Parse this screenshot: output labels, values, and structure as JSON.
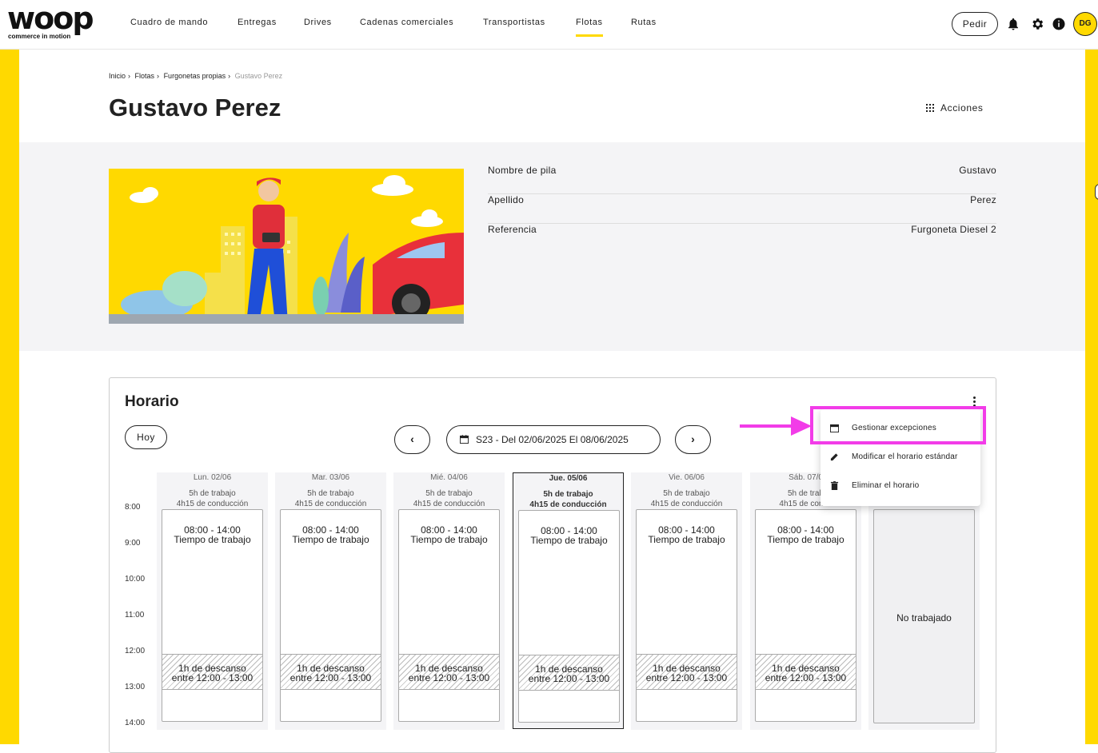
{
  "brand": {
    "logo_text": "woop",
    "tagline": "commerce in motion",
    "accent": "#ffd900"
  },
  "nav": {
    "items": [
      "Cuadro de mando",
      "Entregas",
      "Drives",
      "Cadenas comerciales",
      "Transportistas",
      "Flotas",
      "Rutas"
    ],
    "active": "Flotas",
    "pedir_label": "Pedir",
    "avatar_initials": "DG"
  },
  "breadcrumb": [
    "Inicio",
    "Flotas",
    "Furgonetas propias",
    "Gustavo Perez"
  ],
  "page_title": "Gustavo Perez",
  "acciones_label": "Acciones",
  "info": [
    {
      "key": "Nombre de pila",
      "value": "Gustavo"
    },
    {
      "key": "Apellido",
      "value": "Perez"
    },
    {
      "key": "Referencia",
      "value": "Furgoneta Diesel 2"
    }
  ],
  "schedule": {
    "title": "Horario",
    "today_label": "Hoy",
    "week_label": "S23 - Del 02/06/2025 El 08/06/2025",
    "hours": [
      "8:00",
      "9:00",
      "10:00",
      "11:00",
      "12:00",
      "13:00",
      "14:00"
    ],
    "days": [
      {
        "name": "Lun. 02/06",
        "work": "5h de trabajo",
        "drive": "4h15 de conducción",
        "slot": "08:00 - 14:00",
        "slot_label": "Tiempo de trabajo",
        "break1": "1h de descanso",
        "break2": "entre 12:00 - 13:00"
      },
      {
        "name": "Mar. 03/06",
        "work": "5h de trabajo",
        "drive": "4h15 de conducción",
        "slot": "08:00 - 14:00",
        "slot_label": "Tiempo de trabajo",
        "break1": "1h de descanso",
        "break2": "entre 12:00 - 13:00"
      },
      {
        "name": "Mié. 04/06",
        "work": "5h de trabajo",
        "drive": "4h15 de conducción",
        "slot": "08:00 - 14:00",
        "slot_label": "Tiempo de trabajo",
        "break1": "1h de descanso",
        "break2": "entre 12:00 - 13:00"
      },
      {
        "name": "Jue. 05/06",
        "work": "5h de trabajo",
        "drive": "4h15 de conducción",
        "slot": "08:00 - 14:00",
        "slot_label": "Tiempo de trabajo",
        "break1": "1h de descanso",
        "break2": "entre 12:00 - 13:00"
      },
      {
        "name": "Vie. 06/06",
        "work": "5h de trabajo",
        "drive": "4h15 de conducción",
        "slot": "08:00 - 14:00",
        "slot_label": "Tiempo de trabajo",
        "break1": "1h de descanso",
        "break2": "entre 12:00 - 13:00"
      },
      {
        "name": "Sáb. 07/0",
        "work": "5h de trab",
        "drive": "4h15 de condu",
        "slot": "08:00 - 14:00",
        "slot_label": "Tiempo de trabajo",
        "break1": "1h de descanso",
        "break2": "entre 12:00 - 13:00"
      }
    ],
    "off_label": "No trabajado"
  },
  "menu": {
    "items": [
      {
        "label": "Gestionar excepciones",
        "icon": "calendar-icon"
      },
      {
        "label": "Modificar el horario estándar",
        "icon": "pencil-icon"
      },
      {
        "label": "Eliminar el horario",
        "icon": "trash-icon"
      }
    ]
  },
  "annotation_color": "#f23ce8"
}
